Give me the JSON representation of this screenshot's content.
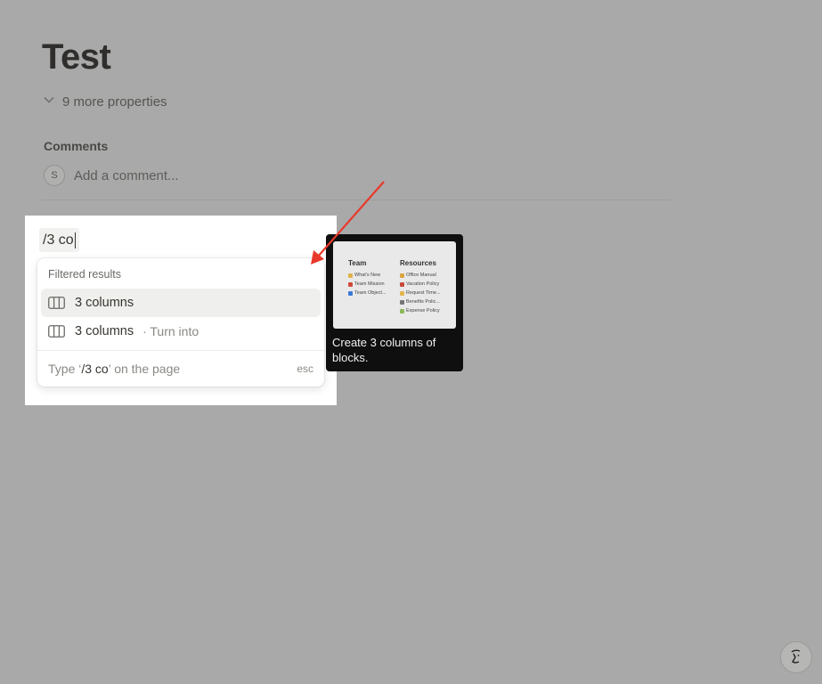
{
  "page": {
    "title": "Test"
  },
  "properties": {
    "toggle_label": "9 more properties"
  },
  "comments": {
    "label": "Comments",
    "avatar_initial": "S",
    "placeholder": "Add a comment..."
  },
  "slash_input": {
    "value": "/3 co"
  },
  "menu": {
    "header": "Filtered results",
    "items": [
      {
        "label": "3 columns",
        "sub": ""
      },
      {
        "label": "3 columns",
        "sub": "· Turn into"
      }
    ],
    "footer": {
      "prefix": "Type ‘",
      "query": "/3 co",
      "suffix": "’ on the page",
      "esc": "esc"
    }
  },
  "tooltip": {
    "preview": {
      "col1_head": "Team",
      "col1": [
        "What's New",
        "Team Mission",
        "Team Object..."
      ],
      "col2_head": "Resources",
      "col2": [
        "Office Manual",
        "Vacation Policy",
        "Request Time...",
        "Benefits Polic...",
        "Expense Policy"
      ]
    },
    "caption": "Create 3 columns of blocks."
  },
  "colors": {
    "overlay": "#a9a9a9",
    "annotation_arrow": "#e8392b",
    "tooltip_bg": "#0f0f0f"
  }
}
